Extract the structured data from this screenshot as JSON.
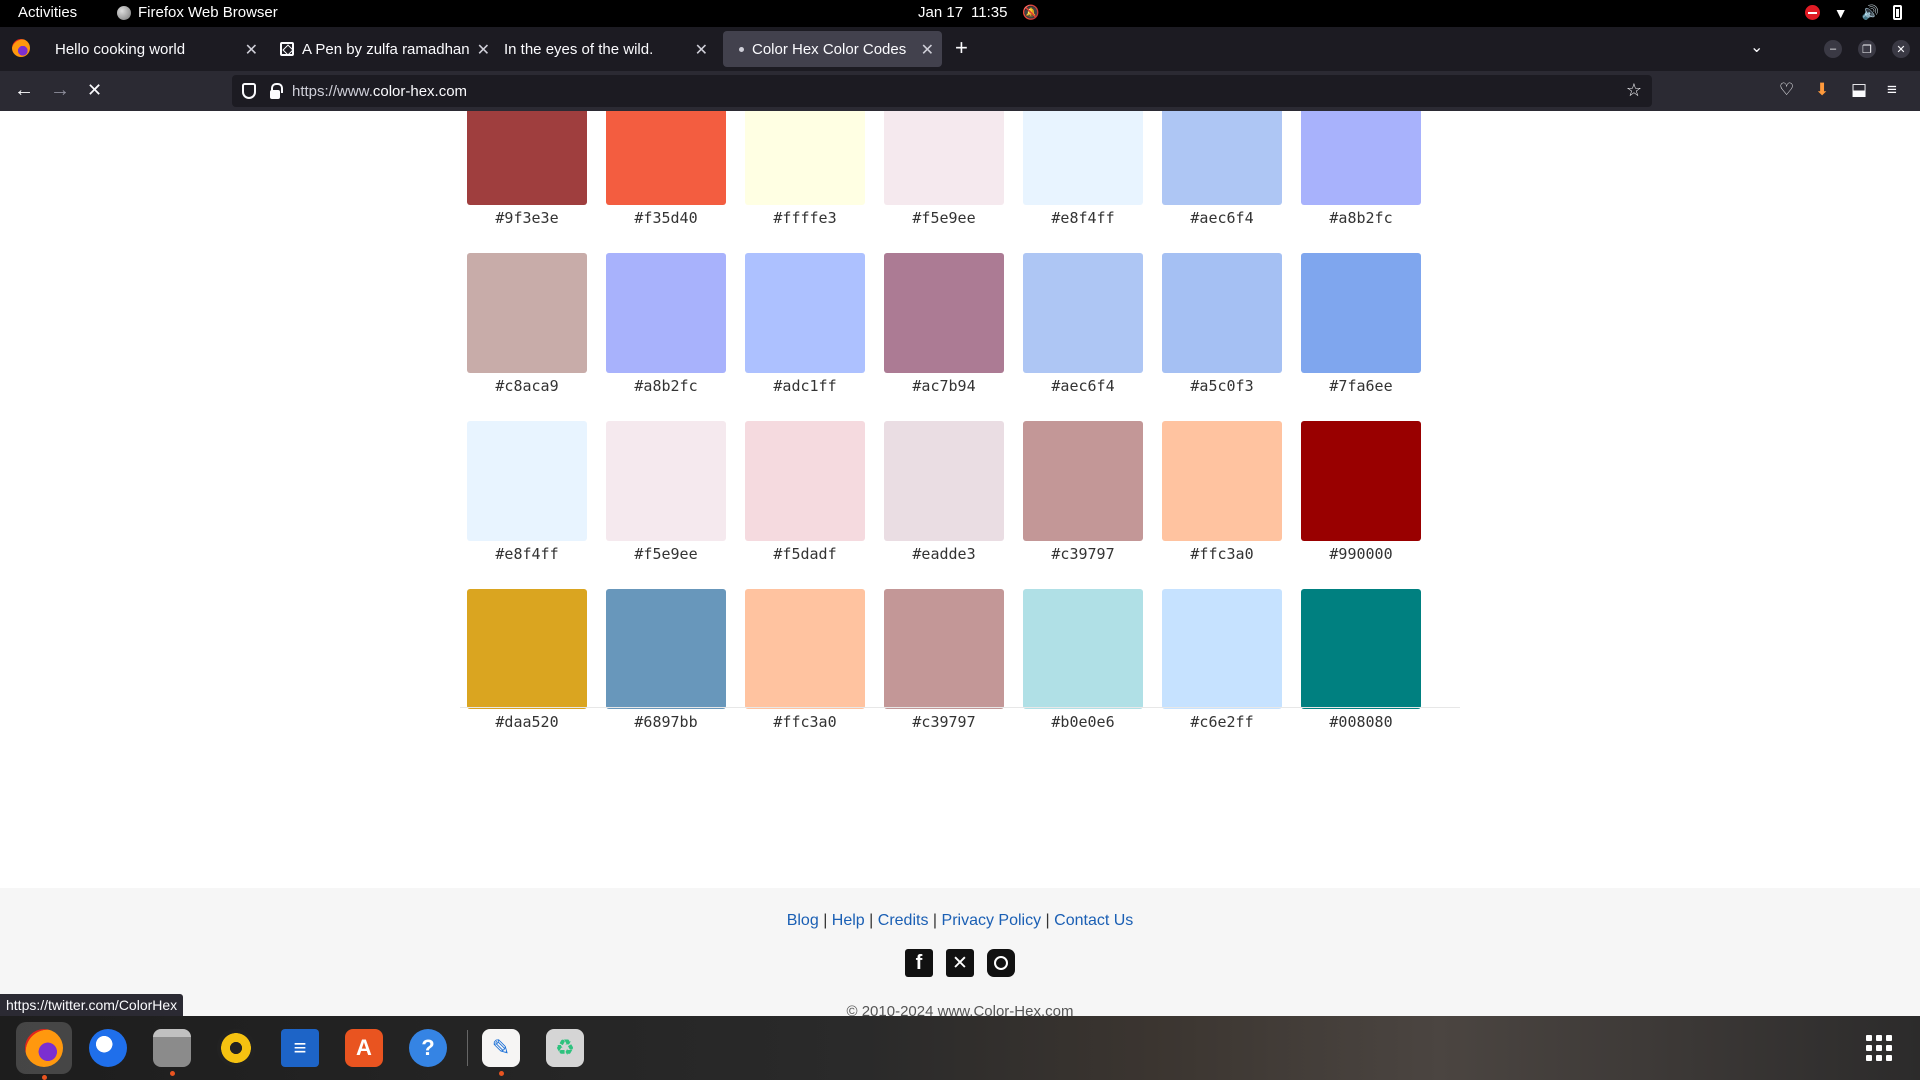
{
  "topbar": {
    "activities": "Activities",
    "app_name": "Firefox Web Browser",
    "date": "Jan 17",
    "time": "11:35"
  },
  "tabs": [
    {
      "title": "Hello cooking world",
      "active": false
    },
    {
      "title": "A Pen by zulfa ramadhan",
      "active": false
    },
    {
      "title": "In the eyes of the wild.",
      "active": false
    },
    {
      "title": "Color Hex Color Codes",
      "active": true
    }
  ],
  "navbar": {
    "url_prefix": "https://www.",
    "url_domain": "color-hex.com"
  },
  "palette": {
    "rows": [
      [
        {
          "hex": "#9f3e3e",
          "color": "#9f3e3e"
        },
        {
          "hex": "#f35d40",
          "color": "#f35d40"
        },
        {
          "hex": "#ffffe3",
          "color": "#ffffe3"
        },
        {
          "hex": "#f5e9ee",
          "color": "#f5e9ee"
        },
        {
          "hex": "#e8f4ff",
          "color": "#e8f4ff"
        },
        {
          "hex": "#aec6f4",
          "color": "#aec6f4"
        },
        {
          "hex": "#a8b2fc",
          "color": "#a8b2fc"
        }
      ],
      [
        {
          "hex": "#c8aca9",
          "color": "#c8aca9"
        },
        {
          "hex": "#a8b2fc",
          "color": "#a8b2fc"
        },
        {
          "hex": "#adc1ff",
          "color": "#adc1ff"
        },
        {
          "hex": "#ac7b94",
          "color": "#ac7b94"
        },
        {
          "hex": "#aec6f4",
          "color": "#aec6f4"
        },
        {
          "hex": "#a5c0f3",
          "color": "#a5c0f3"
        },
        {
          "hex": "#7fa6ee",
          "color": "#7fa6ee"
        }
      ],
      [
        {
          "hex": "#e8f4ff",
          "color": "#e8f4ff"
        },
        {
          "hex": "#f5e9ee",
          "color": "#f5e9ee"
        },
        {
          "hex": "#f5dadf",
          "color": "#f5dadf"
        },
        {
          "hex": "#eadde3",
          "color": "#eadde3"
        },
        {
          "hex": "#c39797",
          "color": "#c39797"
        },
        {
          "hex": "#ffc3a0",
          "color": "#ffc3a0"
        },
        {
          "hex": "#990000",
          "color": "#990000"
        }
      ],
      [
        {
          "hex": "#daa520",
          "color": "#daa520"
        },
        {
          "hex": "#6897bb",
          "color": "#6897bb"
        },
        {
          "hex": "#ffc3a0",
          "color": "#ffc3a0"
        },
        {
          "hex": "#c39797",
          "color": "#c39797"
        },
        {
          "hex": "#b0e0e6",
          "color": "#b0e0e6"
        },
        {
          "hex": "#c6e2ff",
          "color": "#c6e2ff"
        },
        {
          "hex": "#008080",
          "color": "#008080"
        }
      ]
    ]
  },
  "footer": {
    "links": {
      "blog": "Blog",
      "help": "Help",
      "credits": "Credits",
      "privacy": "Privacy Policy",
      "contact": "Contact Us"
    },
    "separator": "|",
    "copyright": "© 2010-2024 www.Color-Hex.com"
  },
  "status_link": "https://twitter.com/ColorHex",
  "dock": {
    "apps": [
      "firefox-icon",
      "thunderbird-icon",
      "files-icon",
      "rhythmbox-icon",
      "writer-icon",
      "app-center-icon",
      "help-icon",
      "text-editor-icon",
      "trash-icon"
    ]
  }
}
